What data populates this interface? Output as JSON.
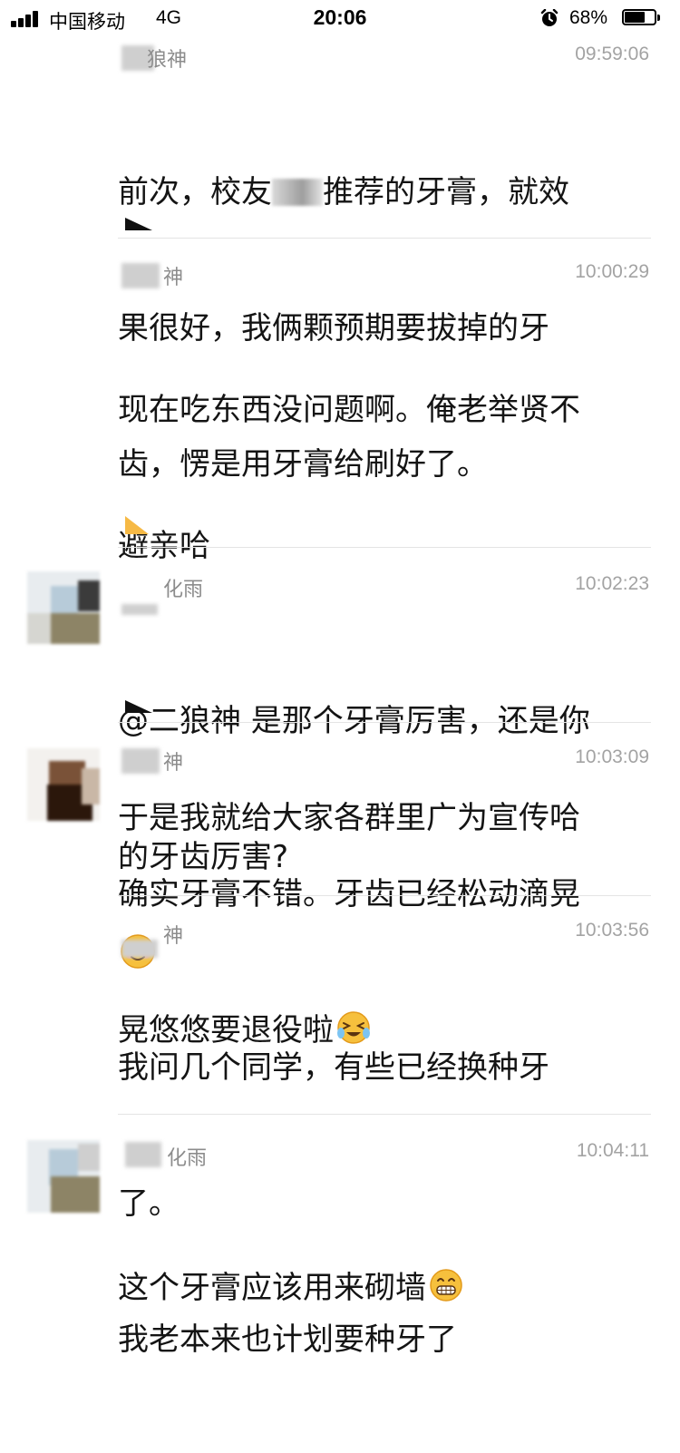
{
  "status_bar": {
    "carrier": "中国移动",
    "network": "4G",
    "time": "20:06",
    "battery_percent_label": "68%",
    "battery_level": 0.68
  },
  "messages": [
    {
      "sender": "狼神",
      "time": "09:59:06",
      "lines": [
        "前次，校友",
        "推荐的牙膏，就效",
        "果很好，我俩颗预期要拔掉的牙",
        "齿，愣是用牙膏给刷好了。"
      ]
    },
    {
      "sender": "神",
      "time": "10:00:29",
      "lines": [
        "现在吃东西没问题啊。俺老举贤不",
        "避亲哈",
        "",
        "于是我就给大家各群里广为宣传哈"
      ]
    },
    {
      "sender": "化雨",
      "time": "10:02:23",
      "lines": [
        "@二狼神 是那个牙膏厉害，还是你",
        "的牙齿厉害?"
      ]
    },
    {
      "sender": "神",
      "time": "10:03:09",
      "lines": [
        "确实牙膏不错。牙齿已经松动滴晃",
        "晃悠悠要退役啦"
      ]
    },
    {
      "sender": "神",
      "time": "10:03:56",
      "lines": [
        "我问几个同学，有些已经换种牙",
        "了。",
        "我老本来也计划要种牙了"
      ]
    },
    {
      "sender": "化雨",
      "time": "10:04:11",
      "lines": [
        "这个牙膏应该用来砌墙"
      ]
    }
  ],
  "icons": {
    "signal": "signal-bars-icon",
    "alarm": "alarm-clock-icon",
    "battery": "battery-icon",
    "smile": "smiling-face-emoji",
    "crying": "tears-of-joy-emoji",
    "grin": "grinning-face-emoji"
  },
  "colors": {
    "text": "#141414",
    "meta": "#a3a3a3",
    "divider": "#e4e4e4",
    "emoji": "#f6c03d"
  }
}
